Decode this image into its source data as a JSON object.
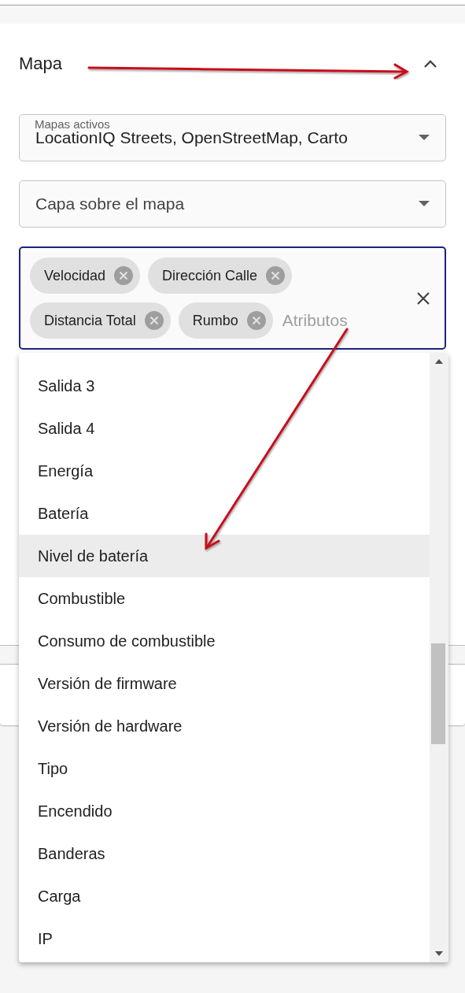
{
  "section": {
    "title": "Mapa",
    "expanded": true
  },
  "active_maps": {
    "label": "Mapas activos",
    "value": "LocationIQ Streets, OpenStreetMap, Carto"
  },
  "overlay_layer": {
    "placeholder": "Capa sobre el mapa"
  },
  "attributes": {
    "placeholder": "Atributos",
    "focused": true,
    "chips": [
      "Velocidad",
      "Dirección Calle",
      "Distancia Total",
      "Rumbo"
    ]
  },
  "options": [
    {
      "label": "Salida 3",
      "highlighted": false
    },
    {
      "label": "Salida 4",
      "highlighted": false
    },
    {
      "label": "Energía",
      "highlighted": false
    },
    {
      "label": "Batería",
      "highlighted": false
    },
    {
      "label": "Nivel de batería",
      "highlighted": true
    },
    {
      "label": "Combustible",
      "highlighted": false
    },
    {
      "label": "Consumo de combustible",
      "highlighted": false
    },
    {
      "label": "Versión de firmware",
      "highlighted": false
    },
    {
      "label": "Versión de hardware",
      "highlighted": false
    },
    {
      "label": "Tipo",
      "highlighted": false
    },
    {
      "label": "Encendido",
      "highlighted": false
    },
    {
      "label": "Banderas",
      "highlighted": false
    },
    {
      "label": "Carga",
      "highlighted": false
    },
    {
      "label": "IP",
      "highlighted": false
    }
  ]
}
